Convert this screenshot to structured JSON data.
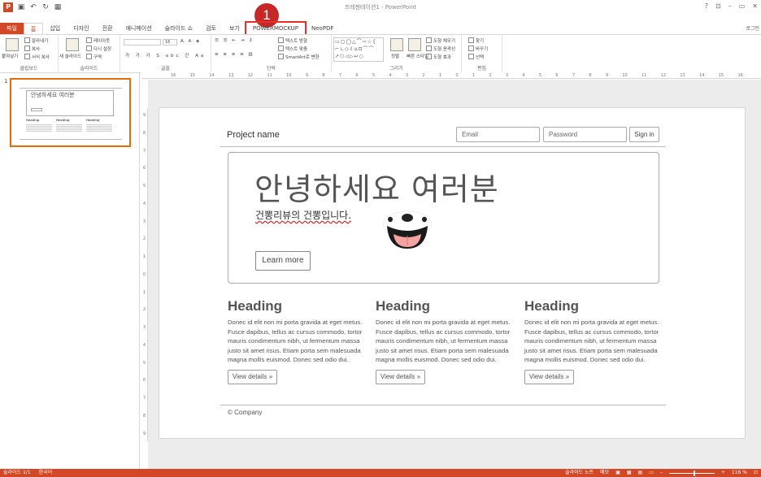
{
  "window": {
    "title": "프레젠테이션1 - PowerPoint",
    "controls": [
      "?",
      "⊡",
      "–",
      "▭",
      "✕"
    ],
    "login": "로그인"
  },
  "tabs": [
    "파일",
    "홈",
    "삽입",
    "디자인",
    "전환",
    "애니메이션",
    "슬라이드 쇼",
    "검토",
    "보기",
    "POWERMOCKUP",
    "NeoPDF"
  ],
  "callout_number": "1",
  "ribbon": {
    "clipboard": {
      "paste": "붙여넣기",
      "cut": "잘라내기",
      "copy": "복사",
      "format": "서식 복사",
      "label": "클립보드"
    },
    "slides": {
      "new": "새 슬라이드",
      "layout": "레이아웃",
      "reset": "다시 설정",
      "section": "구역",
      "label": "슬라이드"
    },
    "font": {
      "size": "16",
      "label": "글꼴"
    },
    "paragraph": {
      "dir": "텍스트 방향",
      "align": "텍스트 맞춤",
      "smartart": "SmartArt로 변환",
      "label": "단락"
    },
    "drawing": {
      "arrange": "정렬",
      "quickstyle": "빠른 스타일",
      "fill": "도형 채우기",
      "outline": "도형 윤곽선",
      "effect": "도형 효과",
      "label": "그리기"
    },
    "editing": {
      "find": "찾기",
      "replace": "바꾸기",
      "select": "선택",
      "label": "편집"
    }
  },
  "ruler_ticks": [
    "16",
    "15",
    "14",
    "13",
    "12",
    "11",
    "10",
    "9",
    "8",
    "7",
    "6",
    "5",
    "4",
    "3",
    "2",
    "1",
    "0",
    "1",
    "2",
    "3",
    "4",
    "5",
    "6",
    "7",
    "8",
    "9",
    "10",
    "11",
    "12",
    "13",
    "14",
    "15",
    "16"
  ],
  "vruler_ticks": [
    "9",
    "8",
    "7",
    "6",
    "5",
    "4",
    "3",
    "2",
    "1",
    "0",
    "1",
    "2",
    "3",
    "4",
    "5",
    "6",
    "7",
    "8",
    "9"
  ],
  "thumbnail": {
    "number": "1",
    "hello": "안녕하세요 여러분",
    "heading": "Heading"
  },
  "slide": {
    "project_name": "Project name",
    "email_placeholder": "Email",
    "password_placeholder": "Password",
    "sign_in": "Sign in",
    "jumbo_title": "안녕하세요 여러분",
    "jumbo_sub": "건뽕리뷰의 건뽕입니다.",
    "learn_more": "Learn more",
    "columns": [
      {
        "heading": "Heading",
        "body": "Donec id elit non mi porta gravida at eget metus. Fusce dapibus, tellus ac cursus commodo, tortor mauris condimentum nibh, ut fermentum massa justo sit amet risus. Etiam porta sem malesuada magna mollis euismod. Donec sed odio dui.",
        "button": "View details »"
      },
      {
        "heading": "Heading",
        "body": "Donec id elit non mi porta gravida at eget metus. Fusce dapibus, tellus ac cursus commodo, tortor mauris condimentum nibh, ut fermentum massa justo sit amet risus. Etiam porta sem malesuada magna mollis euismod. Donec sed odio dui.",
        "button": "View details »"
      },
      {
        "heading": "Heading",
        "body": "Donec id elit non mi porta gravida at eget metus. Fusce dapibus, tellus ac cursus commodo, tortor mauris condimentum nibh, ut fermentum massa justo sit amet risus. Etiam porta sem malesuada magna mollis euismod. Donec sed odio dui.",
        "button": "View details »"
      }
    ],
    "footer": "© Company"
  },
  "status": {
    "slide_count": "슬라이드 1/1",
    "language": "한국어",
    "notes": "슬라이드 노트",
    "memo": "메모",
    "zoom": "116 %"
  },
  "colors": {
    "accent": "#d24726",
    "highlight": "#e8302b",
    "callout": "#c62828"
  }
}
